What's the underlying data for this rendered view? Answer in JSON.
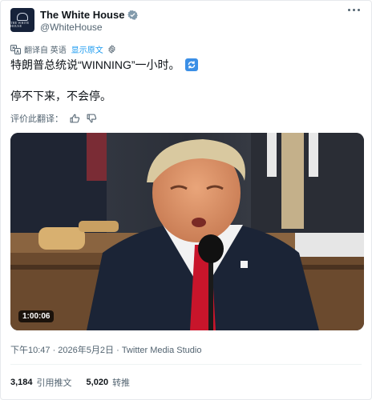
{
  "author": {
    "display_name": "The White House",
    "handle": "@WhiteHouse",
    "avatar_text": "THE WHITE HOUSE",
    "verified_icon": "verified-badge-icon"
  },
  "translation": {
    "translated_from": "翻译自 英语",
    "show_original": "显示原文"
  },
  "tweet": {
    "line1": "特朗普总统说“WINNING”一小时。",
    "line2": "停不下来，不会停。"
  },
  "rate_translation": {
    "label": "评价此翻译："
  },
  "media": {
    "duration": "1:00:06"
  },
  "meta": {
    "timestamp": "下午10:47 · 2026年5月2日",
    "source": "Twitter Media Studio"
  },
  "stats": {
    "retweets_count": "3,184",
    "retweets_label": "引用推文",
    "quotes_count": "5,020",
    "quotes_label": "转推"
  },
  "colors": {
    "link": "#1d9bf0",
    "muted": "#536471",
    "verified": "#829aab"
  }
}
